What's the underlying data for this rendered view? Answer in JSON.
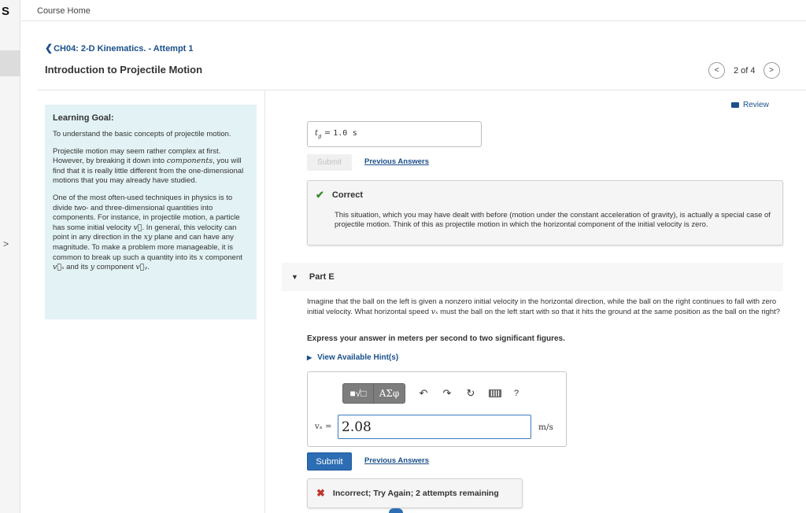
{
  "app": {
    "logo": "S",
    "course_home": "Course Home",
    "rail_expand": ">"
  },
  "assignment": {
    "back_chevron": "❮",
    "back_link": "CH04: 2-D Kinematics. - Attempt 1",
    "title": "Introduction to Projectile Motion"
  },
  "pager": {
    "text": "2 of 4",
    "prev_icon": "chevron-left",
    "next_icon": "chevron-right",
    "prev_glyph": "<",
    "next_glyph": ">"
  },
  "review": {
    "label": "Review"
  },
  "learning_goal": {
    "heading": "Learning Goal:",
    "p1": "To understand the basic concepts of projectile motion.",
    "p2_a": "Projectile motion may seem rather complex at first. However, by breaking it down into ",
    "p2_em": "components",
    "p2_b": ", you will find that it is really little different from the one-dimensional motions that you may already have studied.",
    "p3_a": "One of the most often-used techniques in physics is to divide two- and three-dimensional quantities into components. For instance, in projectile motion, a particle has some initial velocity ",
    "p3_v": "v⃗",
    "p3_b": ". In general, this velocity can point in any direction in the ",
    "p3_xy": "xy",
    "p3_c": " plane and can have any magnitude. To make a problem more manageable, it is common to break up such a quantity into its ",
    "p3_x": "x",
    "p3_d": " component ",
    "p3_vx": "v⃗ₓ",
    "p3_e": " and its ",
    "p3_y": "y",
    "p3_f": " component ",
    "p3_vy": "v⃗ᵧ",
    "p3_g": "."
  },
  "part_d": {
    "answer_var": "t",
    "answer_sub": "g",
    "answer_eq": " = ",
    "answer_value": "1.0",
    "answer_unit": "s",
    "submit_label": "Submit",
    "previous_answers": "Previous Answers",
    "feedback_title": "Correct",
    "feedback_text": "This situation, which you may have dealt with before (motion under the constant acceleration of gravity), is actually a special case of projectile motion. Think of this as projectile motion in which the horizontal component of the initial velocity is zero."
  },
  "part_e": {
    "label": "Part E",
    "question_a": "Imagine that the ball on the left is given a nonzero initial velocity in the horizontal direction, while the ball on the right continues to fall with zero initial velocity. What horizontal speed ",
    "question_var": "vₓ",
    "question_b": " must the ball on the left start with so that it hits the ground at the same position as the ball on the right?",
    "instruction": "Express your answer in meters per second to two significant figures.",
    "hints": "View Available Hint(s)",
    "toolbar": {
      "templates_glyph": "■√□",
      "symbols_glyph": "ΑΣφ",
      "undo_glyph": "↶",
      "redo_glyph": "↷",
      "reset_glyph": "↻",
      "help_glyph": "?"
    },
    "input_label": "vₓ =",
    "input_value": "2.08",
    "unit": "m/s",
    "submit_label": "Submit",
    "previous_answers": "Previous Answers",
    "feedback_title": "Incorrect; Try Again; 2 attempts remaining"
  }
}
